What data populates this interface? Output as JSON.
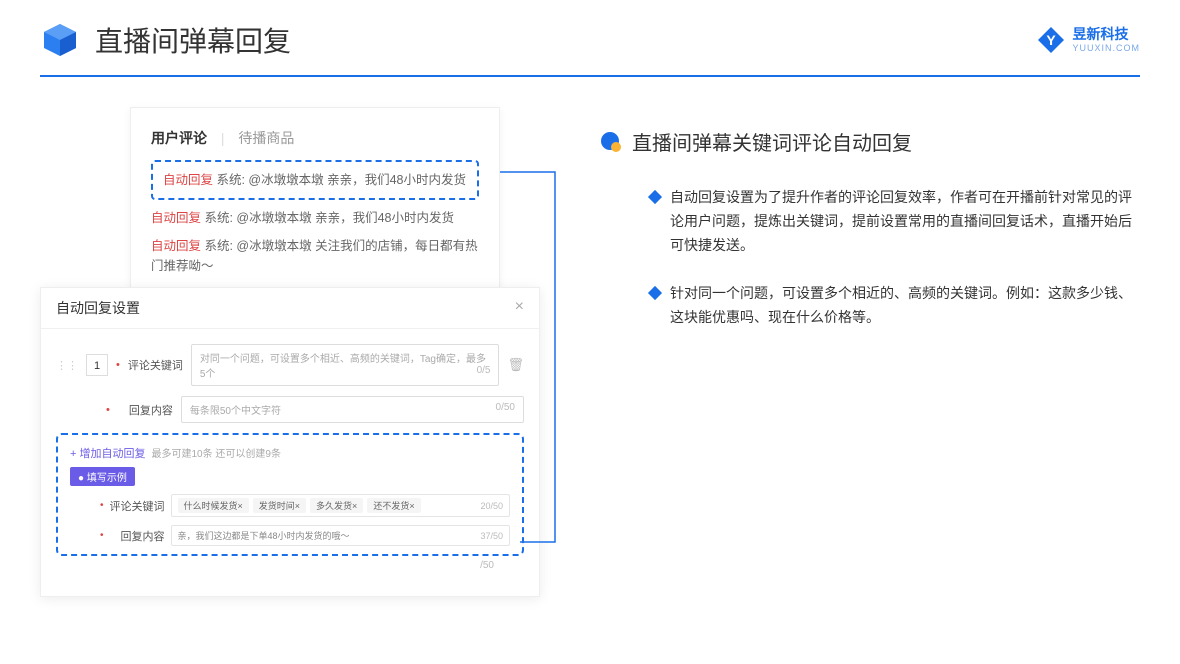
{
  "header": {
    "title": "直播间弹幕回复"
  },
  "brand": {
    "name": "昱新科技",
    "sub": "YUUXIN.COM"
  },
  "comments": {
    "tab_active": "用户评论",
    "tab_inactive": "待播商品",
    "highlighted": {
      "prefix": "自动回复",
      "text": " 系统: @冰墩墩本墩 亲亲，我们48小时内发货"
    },
    "rows": [
      {
        "prefix": "自动回复",
        "text": " 系统: @冰墩墩本墩 亲亲，我们48小时内发货"
      },
      {
        "prefix": "自动回复",
        "text": " 系统: @冰墩墩本墩 关注我们的店铺，每日都有热门推荐呦～"
      }
    ]
  },
  "settings": {
    "title": "自动回复设置",
    "order": "1",
    "keyword_label": "评论关键词",
    "keyword_placeholder": "对同一个问题，可设置多个相近、高频的关键词，Tag确定，最多5个",
    "keyword_count": "0/5",
    "content_label": "回复内容",
    "content_placeholder": "每条限50个中文字符",
    "content_count": "0/50",
    "add_link": "+ 增加自动回复",
    "add_note": "最多可建10条 还可以创建9条",
    "example_badge": "● 填写示例",
    "example_kw_label": "评论关键词",
    "example_tags": [
      "什么时候发货×",
      "发货时间×",
      "多久发货×",
      "还不发货×"
    ],
    "example_kw_count": "20/50",
    "example_content_label": "回复内容",
    "example_content": "亲，我们这边都是下单48小时内发货的哦～",
    "example_content_count": "37/50",
    "outer_count": "/50"
  },
  "right": {
    "section_title": "直播间弹幕关键词评论自动回复",
    "bullets": [
      "自动回复设置为了提升作者的评论回复效率，作者可在开播前针对常见的评论用户问题，提炼出关键词，提前设置常用的直播间回复话术，直播开始后可快捷发送。",
      "针对同一个问题，可设置多个相近的、高频的关键词。例如：这款多少钱、这块能优惠吗、现在什么价格等。"
    ]
  }
}
